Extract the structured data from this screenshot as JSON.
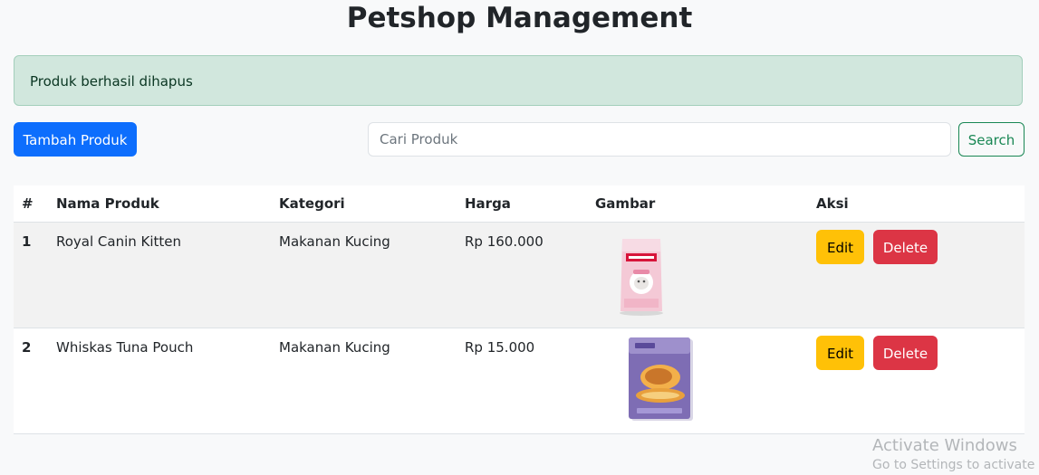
{
  "page": {
    "title": "Petshop Management"
  },
  "alert": {
    "message": "Produk berhasil dihapus"
  },
  "toolbar": {
    "add_label": "Tambah Produk",
    "search_placeholder": "Cari Produk",
    "search_label": "Search"
  },
  "table": {
    "headers": [
      "#",
      "Nama Produk",
      "Kategori",
      "Harga",
      "Gambar",
      "Aksi"
    ],
    "rows": [
      {
        "no": "1",
        "name": "Royal Canin Kitten",
        "category": "Makanan Kucing",
        "price": "Rp 160.000",
        "image": "royal-canin-kitten-bag",
        "edit": "Edit",
        "delete": "Delete"
      },
      {
        "no": "2",
        "name": "Whiskas Tuna Pouch",
        "category": "Makanan Kucing",
        "price": "Rp 15.000",
        "image": "gravy-sensations-pouch",
        "edit": "Edit",
        "delete": "Delete"
      }
    ]
  },
  "watermark": {
    "line1": "Activate Windows",
    "line2": "Go to Settings to activate W"
  },
  "colors": {
    "primary": "#0d6efd",
    "success": "#198754",
    "warning": "#ffc107",
    "danger": "#dc3545",
    "alert_bg": "#d1e7dd"
  }
}
